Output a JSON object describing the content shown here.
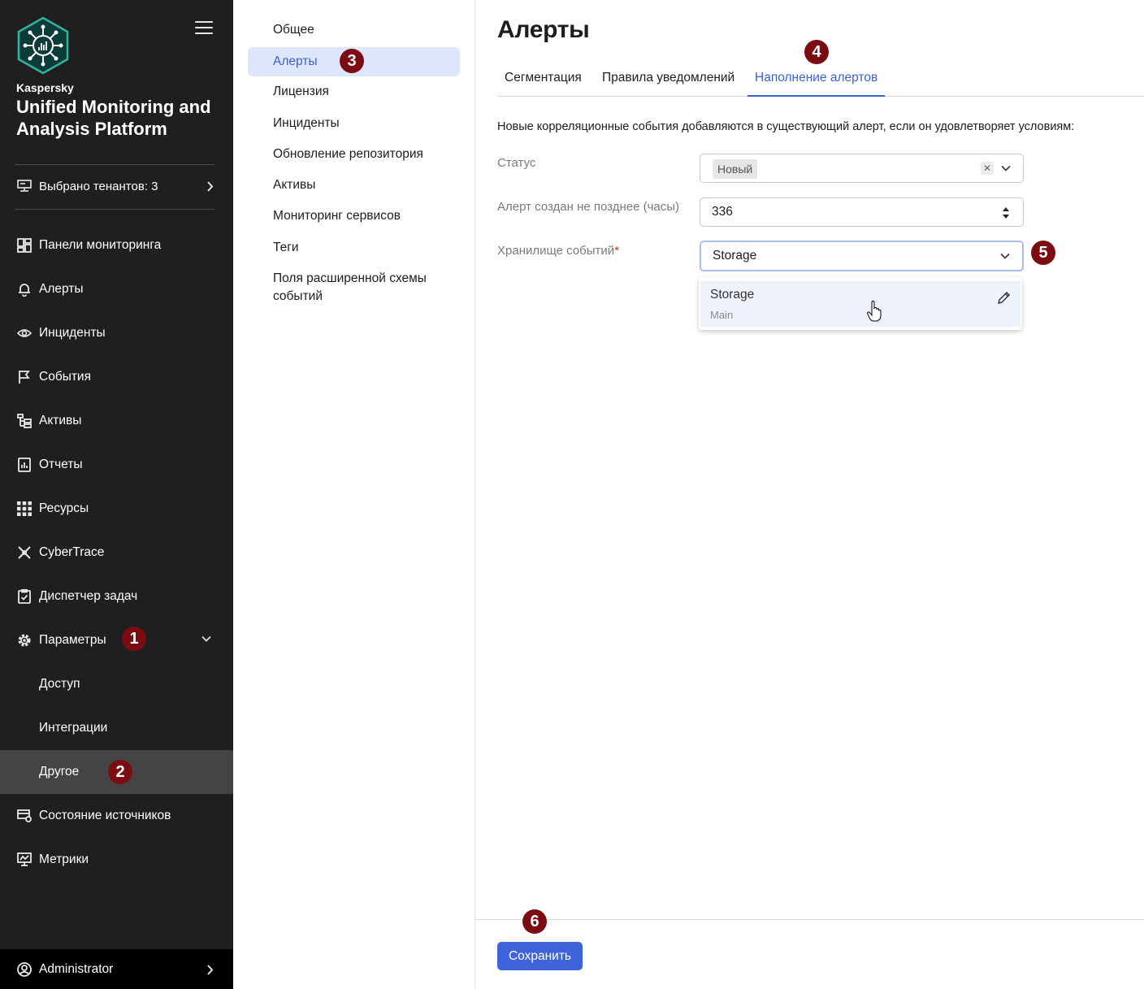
{
  "sidebar": {
    "brand_small": "Kaspersky",
    "brand_title": "Unified Monitoring and Analysis Platform",
    "tenants_label": "Выбрано тенантов: 3",
    "items": [
      {
        "label": "Панели мониторинга",
        "icon": "dashboard-icon"
      },
      {
        "label": "Алерты",
        "icon": "bell-icon"
      },
      {
        "label": "Инциденты",
        "icon": "eye-icon"
      },
      {
        "label": "События",
        "icon": "flag-icon"
      },
      {
        "label": "Активы",
        "icon": "assets-tree-icon"
      },
      {
        "label": "Отчеты",
        "icon": "report-icon"
      },
      {
        "label": "Ресурсы",
        "icon": "grid-icon"
      },
      {
        "label": "CyberTrace",
        "icon": "cybertrace-icon"
      },
      {
        "label": "Диспетчер задач",
        "icon": "clipboard-check-icon"
      },
      {
        "label": "Параметры",
        "icon": "gear-icon"
      },
      {
        "label": "Доступ"
      },
      {
        "label": "Интеграции"
      },
      {
        "label": "Другое"
      },
      {
        "label": "Состояние источников",
        "icon": "source-status-icon"
      },
      {
        "label": "Метрики",
        "icon": "monitor-icon"
      }
    ],
    "user_label": "Administrator"
  },
  "settings_nav": {
    "items": [
      "Общее",
      "Алерты",
      "Лицензия",
      "Инциденты",
      "Обновление репозитория",
      "Активы",
      "Мониторинг сервисов",
      "Теги",
      "Поля расширенной схемы событий"
    ],
    "active": "Алерты"
  },
  "main": {
    "title": "Алерты",
    "tabs": [
      "Сегментация",
      "Правила уведомлений",
      "Наполнение алертов"
    ],
    "active_tab": "Наполнение алертов",
    "intro": "Новые корреляционные события добавляются в существующий алерт, если он удовлетворяет условиям:",
    "fields": {
      "status_label": "Статус",
      "status_chip": "Новый",
      "hours_label": "Алерт создан не позднее (часы)",
      "hours_value": "336",
      "storage_label": "Хранилище событий",
      "storage_required_mark": "*",
      "storage_value": "Storage"
    },
    "dropdown": {
      "option_title": "Storage",
      "option_sub": "Main"
    },
    "save_label": "Сохранить"
  },
  "badges": [
    "1",
    "2",
    "3",
    "4",
    "5",
    "6"
  ],
  "colors": {
    "sidebar_bg": "#1f1f1f",
    "accent": "#3a62d6",
    "badge": "#7b0d12",
    "active_bg": "#dde6fb"
  }
}
